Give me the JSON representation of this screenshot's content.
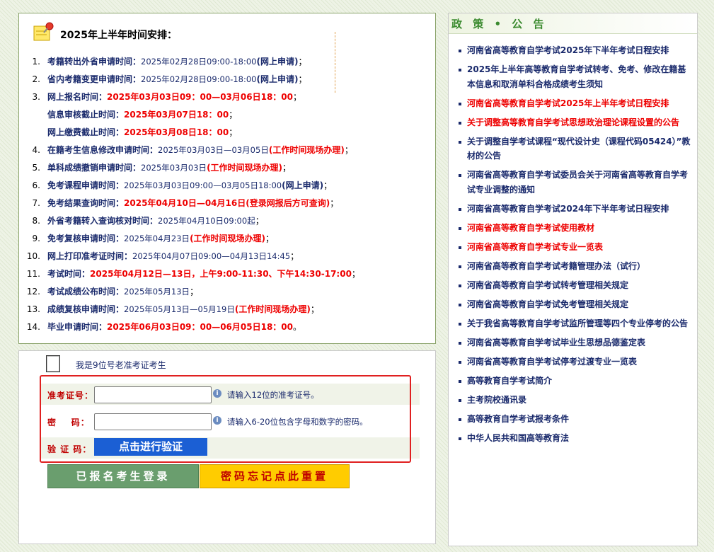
{
  "schedule": {
    "title": "2025年上半年时间安排：",
    "items": [
      {
        "num": "1.",
        "parts": [
          {
            "t": "考籍转出外省申请时间：",
            "c": "lbl"
          },
          {
            "t": "2025年02月28日09:00-18:00",
            "c": "val"
          },
          {
            "t": "(网上申请)",
            "c": "lbl"
          },
          {
            "t": "；",
            "c": "sep"
          }
        ]
      },
      {
        "num": "2.",
        "parts": [
          {
            "t": "省内考籍变更申请时间：",
            "c": "lbl"
          },
          {
            "t": "2025年02月28日09:00-18:00",
            "c": "val"
          },
          {
            "t": "(网上申请)",
            "c": "lbl"
          },
          {
            "t": "；",
            "c": "sep"
          }
        ]
      },
      {
        "num": "3.",
        "parts": [
          {
            "t": "网上报名时间：",
            "c": "lbl"
          },
          {
            "t": "2025年03月03日09：00—03月06日18：00",
            "c": "red"
          },
          {
            "t": "；",
            "c": "sep"
          }
        ]
      },
      {
        "num": "",
        "parts": [
          {
            "t": "信息审核截止时间：",
            "c": "lbl"
          },
          {
            "t": "2025年03月07日18：00",
            "c": "red"
          },
          {
            "t": "；",
            "c": "sep"
          }
        ]
      },
      {
        "num": "",
        "parts": [
          {
            "t": "网上缴费截止时间：",
            "c": "lbl"
          },
          {
            "t": "2025年03月08日18：00",
            "c": "red"
          },
          {
            "t": "；",
            "c": "sep"
          }
        ]
      },
      {
        "num": "4.",
        "parts": [
          {
            "t": "在籍考生信息修改申请时间：",
            "c": "lbl"
          },
          {
            "t": "2025年03月03日—03月05日",
            "c": "val"
          },
          {
            "t": "(工作时间现场办理)",
            "c": "red"
          },
          {
            "t": "；",
            "c": "sep"
          }
        ]
      },
      {
        "num": "5.",
        "parts": [
          {
            "t": "单科成绩撤销申请时间：",
            "c": "lbl"
          },
          {
            "t": "2025年03月03日",
            "c": "val"
          },
          {
            "t": "(工作时间现场办理)",
            "c": "red"
          },
          {
            "t": "；",
            "c": "sep"
          }
        ]
      },
      {
        "num": "6.",
        "parts": [
          {
            "t": "免考课程申请时间：",
            "c": "lbl"
          },
          {
            "t": "2025年03月03日09:00—03月05日18:00",
            "c": "val"
          },
          {
            "t": "(网上申请)",
            "c": "lbl"
          },
          {
            "t": "；",
            "c": "sep"
          }
        ]
      },
      {
        "num": "7.",
        "parts": [
          {
            "t": "免考结果查询时间：",
            "c": "lbl"
          },
          {
            "t": "2025年04月10日—04月16日(登录网报后方可查询)",
            "c": "red"
          },
          {
            "t": "；",
            "c": "sep"
          }
        ]
      },
      {
        "num": "8.",
        "parts": [
          {
            "t": "外省考籍转入查询核对时间：",
            "c": "lbl"
          },
          {
            "t": "2025年04月10日09:00起",
            "c": "val"
          },
          {
            "t": "；",
            "c": "sep"
          }
        ]
      },
      {
        "num": "9.",
        "parts": [
          {
            "t": "免考复核申请时间：",
            "c": "lbl"
          },
          {
            "t": "2025年04月23日",
            "c": "val"
          },
          {
            "t": "(工作时间现场办理)",
            "c": "red"
          },
          {
            "t": "；",
            "c": "sep"
          }
        ]
      },
      {
        "num": "10.",
        "parts": [
          {
            "t": "网上打印准考证时间：",
            "c": "lbl"
          },
          {
            "t": "2025年04月07日09:00—04月13日14:45",
            "c": "val"
          },
          {
            "t": "；",
            "c": "sep"
          }
        ]
      },
      {
        "num": "11.",
        "parts": [
          {
            "t": "考试时间：",
            "c": "lbl"
          },
          {
            "t": "2025年04月12日—13日，上午9:00-11:30、下午14:30-17:00",
            "c": "red"
          },
          {
            "t": "；",
            "c": "sep"
          }
        ]
      },
      {
        "num": "12.",
        "parts": [
          {
            "t": "考试成绩公布时间：",
            "c": "lbl"
          },
          {
            "t": "2025年05月13日",
            "c": "val"
          },
          {
            "t": "；",
            "c": "sep"
          }
        ]
      },
      {
        "num": "13.",
        "parts": [
          {
            "t": "成绩复核申请时间：",
            "c": "lbl"
          },
          {
            "t": "2025年05月13日—05月19日",
            "c": "val"
          },
          {
            "t": "(工作时间现场办理)",
            "c": "red"
          },
          {
            "t": "；",
            "c": "sep"
          }
        ]
      },
      {
        "num": "14.",
        "parts": [
          {
            "t": "毕业申请时间：",
            "c": "lbl"
          },
          {
            "t": "2025年06月03日09：00—06月05日18：00",
            "c": "red"
          },
          {
            "t": "。",
            "c": "sep"
          }
        ]
      }
    ]
  },
  "login": {
    "checkbox_label": "我是9位号老准考证考生",
    "ticket_label": "准考证号：",
    "ticket_value": "",
    "ticket_hint": "请输入12位的准考证号。",
    "password_label": "密    码：",
    "password_value": "",
    "password_hint": "请输入6-20位包含字母和数字的密码。",
    "captcha_label": "验 证 码：",
    "verify_button": "点击进行验证",
    "login_button": "已报名考生登录",
    "reset_button": "密码忘记点此重置",
    "info_icon_glyph": "i"
  },
  "news": {
    "title": "政 策 • 公 告",
    "items": [
      {
        "text": "河南省高等教育自学考试2025年下半年考试日程安排",
        "highlight": false
      },
      {
        "text": "2025年上半年高等教育自学考试转考、免考、修改在籍基本信息和取消单科合格成绩考生须知",
        "highlight": false
      },
      {
        "text": "河南省高等教育自学考试2025年上半年考试日程安排",
        "highlight": true
      },
      {
        "text": "关于调整高等教育自学考试思想政治理论课程设置的公告",
        "highlight": true
      },
      {
        "text": "关于调整自学考试课程“现代设计史（课程代码05424）”教材的公告",
        "highlight": false
      },
      {
        "text": "河南省高等教育自学考试委员会关于河南省高等教育自学考试专业调整的通知",
        "highlight": false
      },
      {
        "text": "河南省高等教育自学考试2024年下半年考试日程安排",
        "highlight": false
      },
      {
        "text": "河南省高等教育自学考试使用教材",
        "highlight": true
      },
      {
        "text": "河南省高等教育自学考试专业一览表",
        "highlight": true
      },
      {
        "text": "河南省高等教育自学考试考籍管理办法（试行）",
        "highlight": false
      },
      {
        "text": "河南省高等教育自学考试转考管理相关规定",
        "highlight": false
      },
      {
        "text": "河南省高等教育自学考试免考管理相关规定",
        "highlight": false
      },
      {
        "text": "关于我省高等教育自学考试监所管理等四个专业停考的公告",
        "highlight": false
      },
      {
        "text": "河南省高等教育自学考试毕业生思想品德鉴定表",
        "highlight": false
      },
      {
        "text": "河南省高等教育自学考试停考过渡专业一览表",
        "highlight": false
      },
      {
        "text": "高等教育自学考试简介",
        "highlight": false
      },
      {
        "text": "主考院校通讯录",
        "highlight": false
      },
      {
        "text": "高等教育自学考试报考条件",
        "highlight": false
      },
      {
        "text": "中华人民共和国高等教育法",
        "highlight": false
      }
    ]
  },
  "colors": {
    "link": "#1a2a6c",
    "highlight": "#ee0000",
    "panel_border": "#8aa36a",
    "verify_button": "#1b5fd4",
    "login_button": "#6a9e6e",
    "reset_button": "#ffcc00",
    "news_title": "#3a8a2e",
    "callout_box": "#e02020"
  },
  "icons": [
    "notepad-pin-icon",
    "info-icon",
    "checkbox"
  ]
}
